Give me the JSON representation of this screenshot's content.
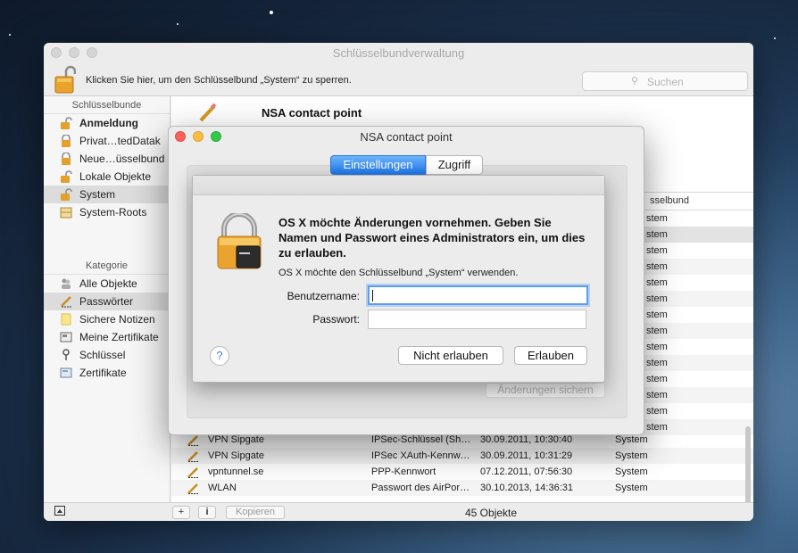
{
  "app": {
    "title": "Schlüsselbundverwaltung",
    "lock_text": "Klicken Sie hier, um den Schlüsselbund „System“ zu sperren.",
    "search_placeholder": "Suchen"
  },
  "sidebar": {
    "keychains_header": "Schlüsselbunde",
    "keychains": [
      {
        "label": "Anmeldung",
        "icon": "lock-open-icon"
      },
      {
        "label": "Privat…tedDatak",
        "icon": "lock-icon"
      },
      {
        "label": "Neue…üsselbund",
        "icon": "lock-icon"
      },
      {
        "label": "Lokale Objekte",
        "icon": "lock-open-icon"
      },
      {
        "label": "System",
        "icon": "lock-open-icon"
      },
      {
        "label": "System-Roots",
        "icon": "cabinet-icon"
      }
    ],
    "category_header": "Kategorie",
    "categories": [
      {
        "label": "Alle Objekte",
        "icon": "people-icon"
      },
      {
        "label": "Passwörter",
        "icon": "pen-icon"
      },
      {
        "label": "Sichere Notizen",
        "icon": "note-icon"
      },
      {
        "label": "Meine Zertifikate",
        "icon": "certificate-icon"
      },
      {
        "label": "Schlüssel",
        "icon": "key-icon"
      },
      {
        "label": "Zertifikate",
        "icon": "certificate-icon"
      }
    ]
  },
  "detail": {
    "name": "NSA contact point"
  },
  "table": {
    "keychain_header": "sselbund",
    "rows": [
      {
        "name": "VPN Sipgate",
        "kind": "IPSec-Schlüssel (Sh…",
        "date": "30.09.2011, 10:30:40",
        "keychain": "System"
      },
      {
        "name": "VPN Sipgate",
        "kind": "IPSec XAuth-Kennw…",
        "date": "30.09.2011, 10:31:29",
        "keychain": "System"
      },
      {
        "name": "vpntunnel.se",
        "kind": "PPP-Kennwort",
        "date": "07.12.2011, 07:56:30",
        "keychain": "System"
      },
      {
        "name": "WLAN",
        "kind": "Passwort des AirPor…",
        "date": "30.10.2013, 14:36:31",
        "keychain": "System"
      }
    ],
    "partial_keychain": [
      "stem",
      "stem",
      "stem",
      "stem",
      "stem",
      "stem",
      "stem",
      "stem",
      "stem",
      "stem",
      "stem",
      "stem",
      "stem",
      "stem"
    ]
  },
  "footer": {
    "plus": "+",
    "info": "i",
    "copy": "Kopieren",
    "count": "45 Objekte"
  },
  "edit_window": {
    "title": "NSA contact point",
    "tab_settings": "Einstellungen",
    "tab_access": "Zugriff",
    "save_changes": "Änderungen sichern"
  },
  "auth": {
    "heading": "OS X möchte Änderungen vornehmen. Geben Sie Namen und Passwort eines Administrators ein, um dies zu erlauben.",
    "subtext": "OS X möchte den Schlüsselbund „System“ verwenden.",
    "username_label": "Benutzername:",
    "username_value": "",
    "password_label": "Passwort:",
    "password_value": "",
    "help": "?",
    "deny": "Nicht erlauben",
    "allow": "Erlauben"
  },
  "colors": {
    "accent": "#1f79ec",
    "close": "#fc605b",
    "minimize": "#fdbc40",
    "zoom": "#34c84a"
  }
}
